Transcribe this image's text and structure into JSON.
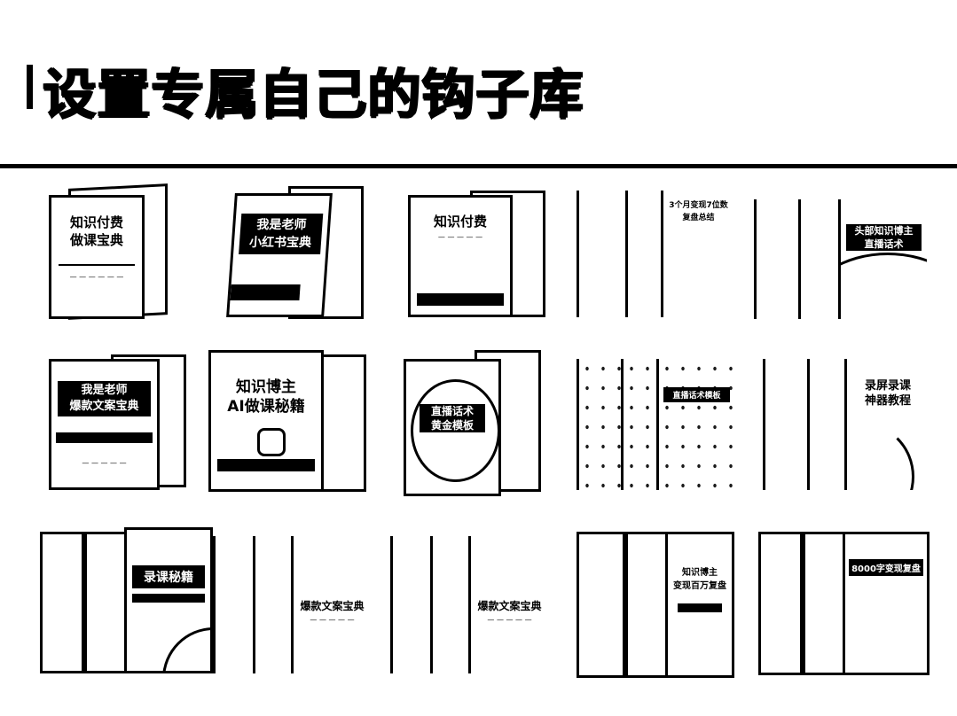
{
  "page": {
    "title": "设置专属自己的钩子库"
  },
  "covers": {
    "r1c1": {
      "title": "知识付费\n做课宝典"
    },
    "r1c2": {
      "title": "我是老师\n小红书宝典"
    },
    "r1c3": {
      "title": "知识付费"
    },
    "r1c4": {
      "title": "3个月变现7位数\n复盘总结"
    },
    "r1c5": {
      "title": "头部知识博主\n直播话术"
    },
    "r2c1": {
      "title": "我是老师\n爆款文案宝典"
    },
    "r2c2": {
      "title": "知识博主\nAI做课秘籍"
    },
    "r2c3": {
      "title": "直播话术\n黄金模板"
    },
    "r2c4": {
      "title": "直播话术模板"
    },
    "r2c5": {
      "title": "录屏录课\n神器教程"
    },
    "r3c1": {
      "title": "录课秘籍"
    },
    "r3c2": {
      "title": "爆款文案宝典"
    },
    "r3c3": {
      "title": "爆款文案宝典"
    },
    "r3c4": {
      "title": "知识博主\n变现百万复盘"
    },
    "r3c5": {
      "title": "8000字变现复盘"
    }
  }
}
